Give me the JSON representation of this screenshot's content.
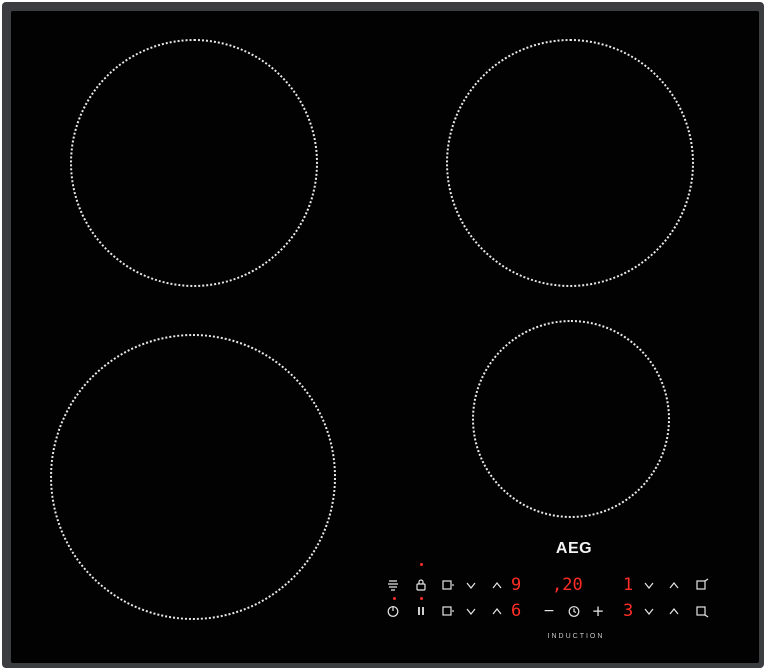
{
  "cooktop": {
    "brand": "AEG",
    "technology_label": "INDUCTION",
    "display_color": "#ff2d26",
    "cooking_zones": [
      "front-left",
      "rear-left",
      "rear-right",
      "front-right"
    ]
  },
  "controls": {
    "row1": {
      "left_zone_level": "9",
      "timer_display": ",20",
      "right_zone_level": "1"
    },
    "row2": {
      "left_zone_level": "6",
      "timer_minus": "−",
      "timer_plus": "+",
      "right_zone_level": "3"
    }
  },
  "icons": {
    "row1": [
      "hob2hood-icon",
      "lock-icon",
      "zone-select-icon",
      "chevron-down-icon",
      "chevron-up-icon",
      "chevron-down-icon",
      "chevron-up-icon",
      "zone-select-icon"
    ],
    "row2": [
      "power-icon",
      "pause-icon",
      "zone-select-icon",
      "chevron-down-icon",
      "chevron-up-icon",
      "timer-icon",
      "chevron-down-icon",
      "chevron-up-icon",
      "zone-select-icon"
    ]
  }
}
